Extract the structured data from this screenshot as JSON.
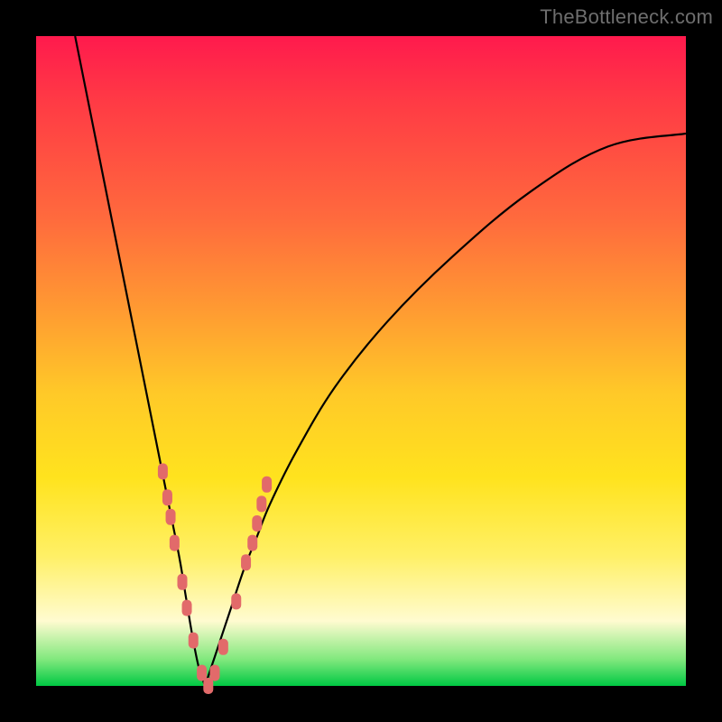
{
  "watermark": "TheBottleneck.com",
  "colors": {
    "background_top": "#ff1a4d",
    "background_bottom": "#00c843",
    "frame": "#000000",
    "curve": "#000000",
    "marker": "#e26a6a",
    "watermark": "#6e6e6e"
  },
  "chart_data": {
    "type": "line",
    "title": "",
    "xlabel": "",
    "ylabel": "",
    "xlim": [
      0,
      100
    ],
    "ylim": [
      0,
      100
    ],
    "grid": false,
    "legend": false,
    "note": "V-shaped bottleneck curve: y rises steeply to ~100 on either side of a minimum near x≈26. Left branch enters top at x≈6; right branch leaves y≈15 at x=100. Coral dot markers cluster near the trough on both branches.",
    "series": [
      {
        "name": "left-branch",
        "x": [
          6,
          8,
          10,
          12,
          14,
          16,
          18,
          20,
          22,
          23,
          24,
          25,
          26
        ],
        "y": [
          100,
          90,
          80,
          70,
          60,
          50,
          40,
          30,
          20,
          14,
          8,
          3,
          0
        ]
      },
      {
        "name": "right-branch",
        "x": [
          26,
          27,
          28,
          29,
          30,
          32,
          34,
          36,
          40,
          46,
          54,
          64,
          76,
          88,
          100
        ],
        "y": [
          0,
          3,
          6,
          9,
          12,
          18,
          23,
          28,
          36,
          46,
          56,
          66,
          76,
          83,
          85
        ]
      }
    ],
    "markers": [
      {
        "x": 19.5,
        "y": 33
      },
      {
        "x": 20.2,
        "y": 29
      },
      {
        "x": 20.7,
        "y": 26
      },
      {
        "x": 21.3,
        "y": 22
      },
      {
        "x": 22.5,
        "y": 16
      },
      {
        "x": 23.2,
        "y": 12
      },
      {
        "x": 24.2,
        "y": 7
      },
      {
        "x": 25.5,
        "y": 2
      },
      {
        "x": 26.5,
        "y": 0
      },
      {
        "x": 27.5,
        "y": 2
      },
      {
        "x": 28.8,
        "y": 6
      },
      {
        "x": 30.8,
        "y": 13
      },
      {
        "x": 32.3,
        "y": 19
      },
      {
        "x": 33.3,
        "y": 22
      },
      {
        "x": 34.0,
        "y": 25
      },
      {
        "x": 34.7,
        "y": 28
      },
      {
        "x": 35.5,
        "y": 31
      }
    ]
  }
}
